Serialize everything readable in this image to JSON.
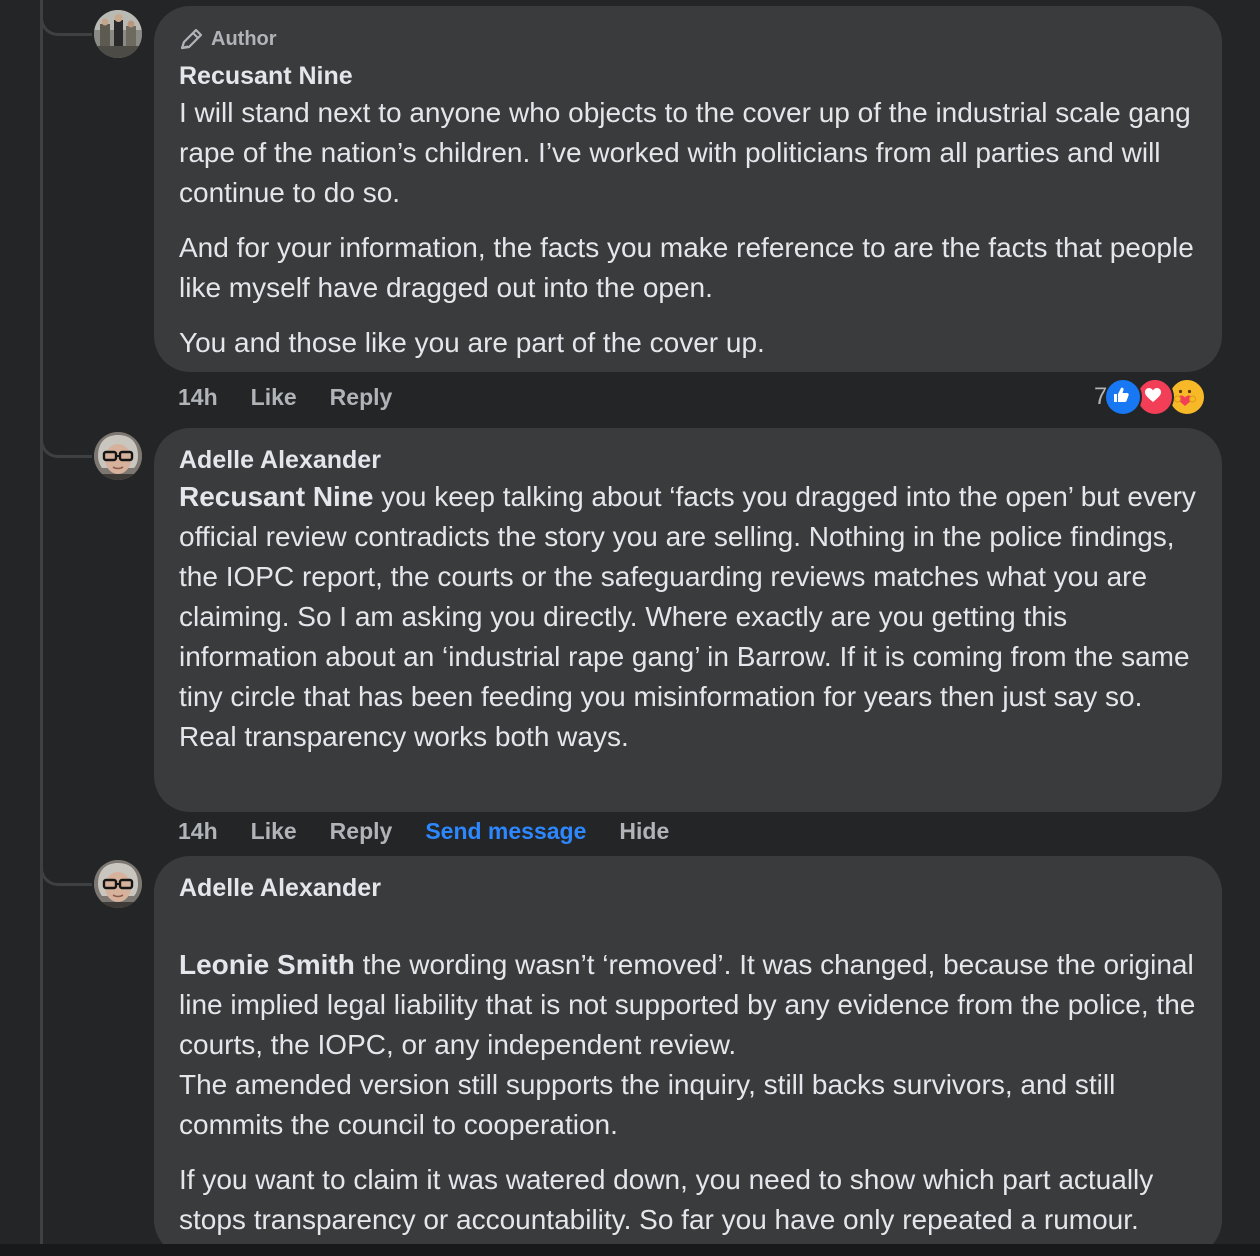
{
  "comments": [
    {
      "author_badge": "Author",
      "name": "Recusant Nine",
      "avatar_icon": "profile-photo-group",
      "paragraphs": [
        {
          "mention": "",
          "text": "I will stand next to anyone who objects to the cover up of the industrial scale gang rape of the nation’s children. I’ve worked with politicians from all parties and will continue to do so."
        },
        {
          "mention": "",
          "text": "And for your information, the facts you make reference to are the facts that people like myself have dragged out into the open."
        },
        {
          "mention": "",
          "text": "You and those like you are part of the cover up."
        }
      ],
      "time": "14h",
      "like_label": "Like",
      "reply_label": "Reply",
      "reaction_count": "7",
      "reaction_icons": [
        "like-reaction-icon",
        "love-reaction-icon",
        "care-reaction-icon"
      ]
    },
    {
      "name": "Adelle Alexander",
      "avatar_icon": "profile-photo-glasses",
      "paragraphs": [
        {
          "mention": "Recusant Nine",
          "text": " you keep talking about ‘facts you dragged into the open’ but every official review contradicts the story you are selling. Nothing in the police findings, the IOPC report, the courts or the safeguarding reviews matches what you are claiming. So I am asking you directly. Where exactly are you getting this information about an ‘industrial rape gang’ in Barrow. If it is coming from the same tiny circle that has been feeding you misinformation for years then just say so. Real transparency works both ways."
        }
      ],
      "time": "14h",
      "like_label": "Like",
      "reply_label": "Reply",
      "send_message_label": "Send message",
      "hide_label": "Hide"
    },
    {
      "name": "Adelle Alexander",
      "avatar_icon": "profile-photo-glasses",
      "paragraphs": [
        {
          "mention": "Leonie Smith",
          "text": " the wording wasn’t ‘removed’. It was changed, because the original line implied legal liability that is not supported by any evidence from the police, the courts, the IOPC, or any independent review.\nThe amended version still supports the inquiry, still backs survivors, and still commits the council to cooperation."
        },
        {
          "mention": "",
          "text": "If you want to claim it was watered down, you need to show which part actually stops transparency or accountability. So far you have only repeated a rumour."
        }
      ]
    }
  ],
  "colors": {
    "background": "#242526",
    "bubble": "#3a3b3c",
    "text": "#e4e6eb",
    "secondary_text": "#b0b3b8",
    "link_blue": "#2d88ff"
  }
}
